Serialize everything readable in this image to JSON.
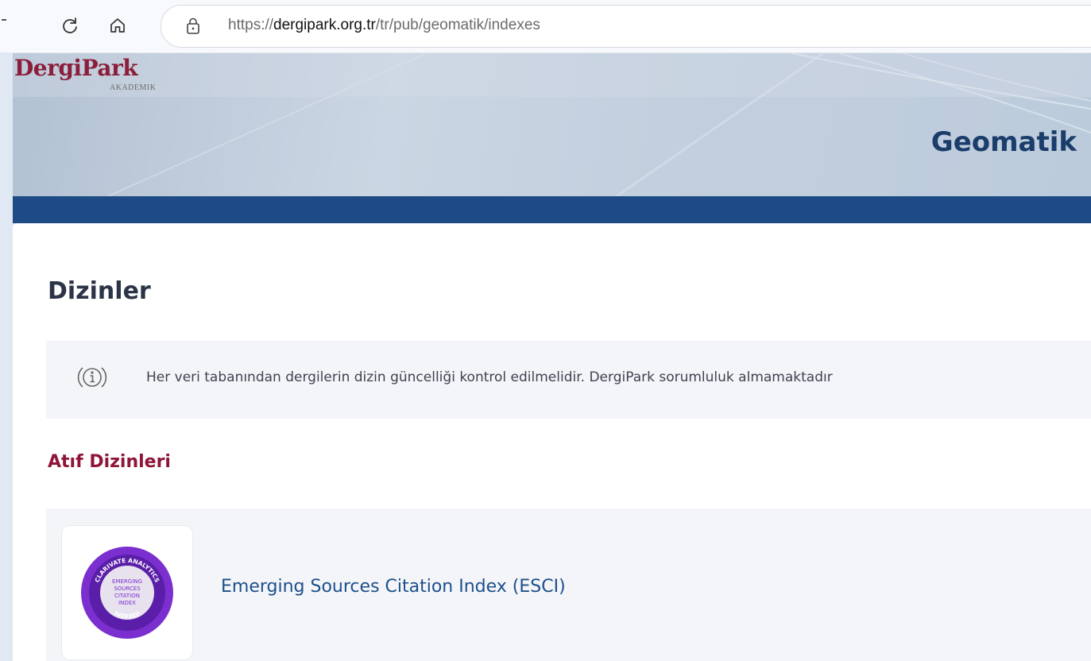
{
  "browser": {
    "url_prefix": "https://",
    "url_domain": "dergipark.org.tr",
    "url_path": "/tr/pub/geomatik/indexes"
  },
  "header": {
    "logo_main": "DergiPark",
    "logo_sub": "AKADEMIK",
    "journal_title": "Geomatik",
    "nav_color": "#1e4a86"
  },
  "main": {
    "heading": "Dizinler",
    "info_text": "Her veri tabanından dergilerin dizin güncelliği kontrol edilmelidir. DergiPark sorumluluk almamaktadır",
    "section_heading": "Atıf Dizinleri",
    "indexes": [
      {
        "name": "Emerging Sources Citation Index (ESCI)",
        "badge_ring_text": "CLARIVATE ANALYTICS",
        "badge_lines": [
          "EMERGING",
          "SOURCES",
          "CITATION",
          "INDEX"
        ],
        "badge_bottom_text": "INDEXED",
        "badge_color": "#7b2fcf"
      }
    ]
  },
  "colors": {
    "heading": "#2c3447",
    "section_heading": "#8e1538",
    "link": "#1d4f8c",
    "logo": "#8b1e3a"
  }
}
